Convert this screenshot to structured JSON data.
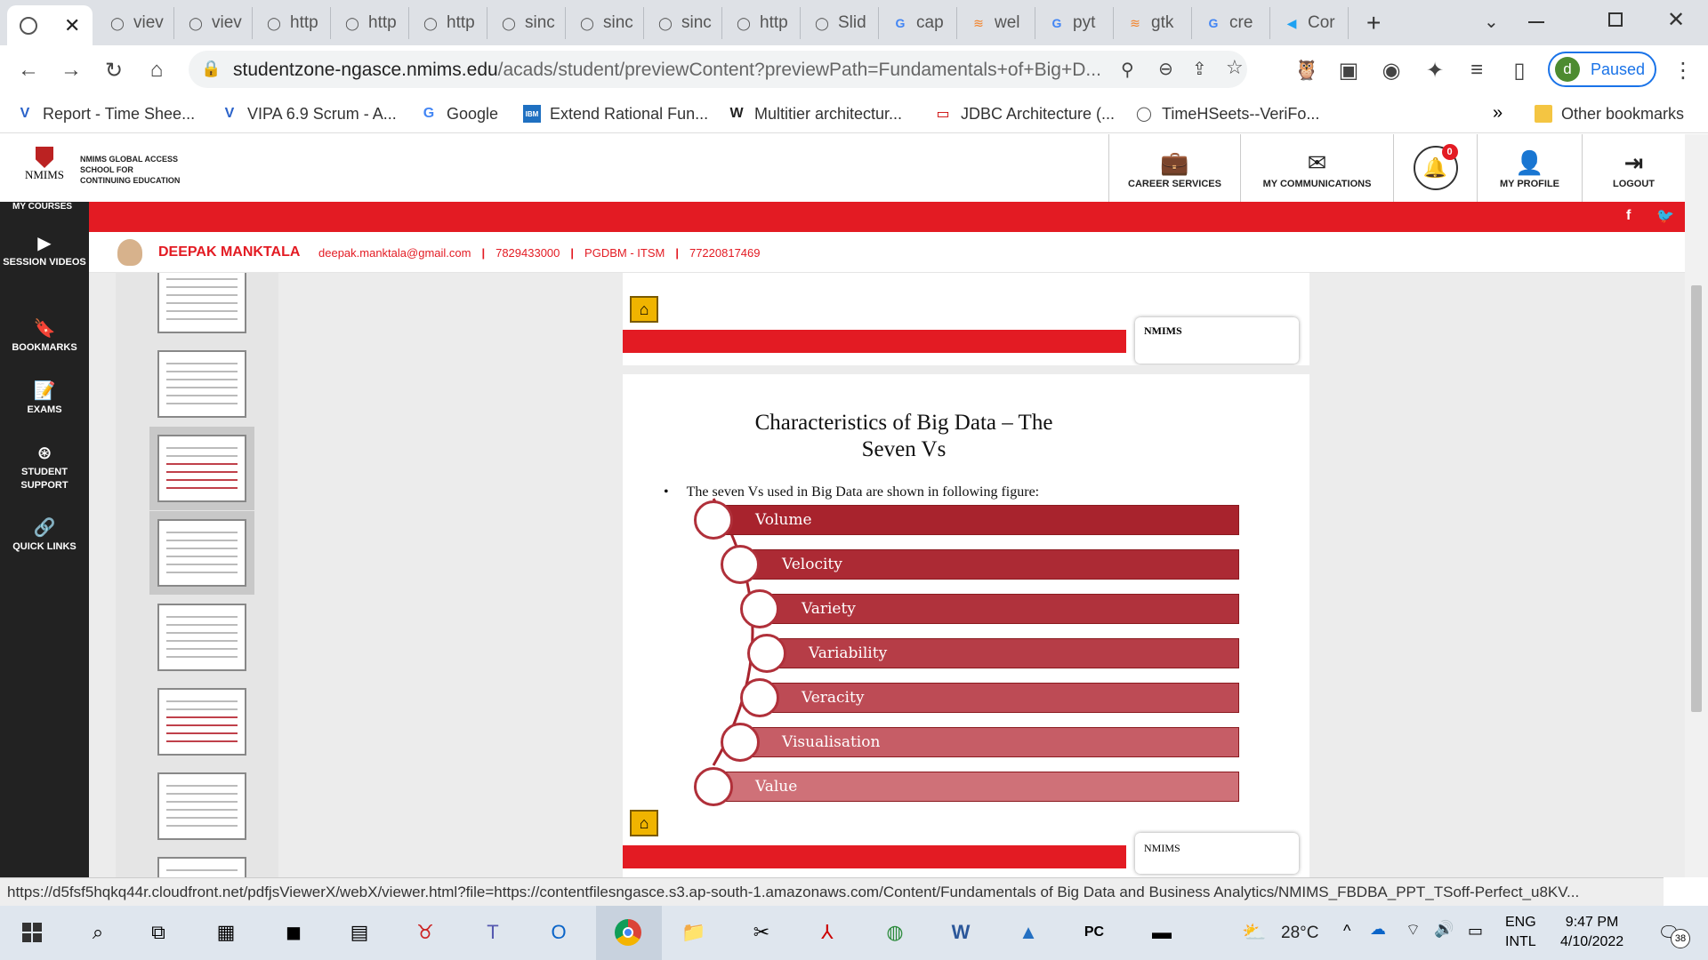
{
  "tabs": [
    {
      "label": "viev",
      "icon": "globe-icon"
    },
    {
      "label": "viev",
      "icon": "globe-icon"
    },
    {
      "label": "http",
      "icon": "globe-icon"
    },
    {
      "label": "http",
      "icon": "globe-icon"
    },
    {
      "label": "http",
      "icon": "globe-icon"
    },
    {
      "label": "sinc",
      "icon": "globe-icon"
    },
    {
      "label": "sinc",
      "icon": "globe-icon"
    },
    {
      "label": "sinc",
      "icon": "globe-icon"
    },
    {
      "label": "http",
      "icon": "globe-icon"
    },
    {
      "label": "Slid",
      "icon": "globe-icon"
    },
    {
      "label": "cap",
      "icon": "google-icon"
    },
    {
      "label": "wel",
      "icon": "stackoverflow-icon"
    },
    {
      "label": "pyt",
      "icon": "google-icon"
    },
    {
      "label": "gtk",
      "icon": "stackoverflow-icon"
    },
    {
      "label": "cre",
      "icon": "google-icon"
    },
    {
      "label": "Cor",
      "icon": "fish-icon"
    }
  ],
  "address": {
    "domain": "studentzone-ngasce.nmims.edu",
    "path": "/acads/student/previewContent?previewPath=Fundamentals+of+Big+D..."
  },
  "profile": {
    "initial": "d",
    "label": "Paused"
  },
  "bookmarks": [
    {
      "label": "Report - Time Shee...",
      "icon": "v-icon"
    },
    {
      "label": "VIPA 6.9 Scrum - A...",
      "icon": "v-icon"
    },
    {
      "label": "Google",
      "icon": "google-icon"
    },
    {
      "label": "Extend Rational Fun...",
      "icon": "ibm-icon"
    },
    {
      "label": "Multitier architectur...",
      "icon": "wikipedia-icon"
    },
    {
      "label": "JDBC Architecture (...",
      "icon": "oracle-icon"
    },
    {
      "label": "TimeHSeets--VeriFo...",
      "icon": "globe-icon"
    }
  ],
  "bookmarks_more": "»",
  "other_bookmarks": "Other bookmarks",
  "site": {
    "logo_text": "NMIMS",
    "school_lines": [
      "NMIMS GLOBAL ACCESS",
      "SCHOOL FOR",
      "CONTINUING EDUCATION"
    ],
    "nav": [
      {
        "label": "CAREER SERVICES",
        "icon": "briefcase-icon"
      },
      {
        "label": "MY COMMUNICATIONS",
        "icon": "envelope-icon"
      },
      {
        "label": "",
        "icon": "bell-icon",
        "badge": "0"
      },
      {
        "label": "MY PROFILE",
        "icon": "user-icon"
      },
      {
        "label": "LOGOUT",
        "icon": "logout-icon"
      }
    ],
    "my_courses": "MY COURSES"
  },
  "sidebar": [
    {
      "label": "SESSION VIDEOS",
      "icon": "play-icon"
    },
    {
      "label": "BOOKMARKS",
      "icon": "bookmark-icon"
    },
    {
      "label": "EXAMS",
      "icon": "exam-icon"
    },
    {
      "label": "STUDENT SUPPORT",
      "icon": "lifebuoy-icon"
    },
    {
      "label": "QUICK LINKS",
      "icon": "link-icon"
    }
  ],
  "user": {
    "name": "DEEPAK MANKTALA",
    "email": "deepak.manktala@gmail.com",
    "phone": "7829433000",
    "program": "PGDBM - ITSM",
    "id": "77220817469"
  },
  "slide": {
    "title_line1": "Characteristics of Big Data – The",
    "title_line2": "Seven Vs",
    "bullet": "The seven Vs used in Big Data are shown in following figure:",
    "vs": [
      "Volume",
      "Velocity",
      "Variety",
      "Variability",
      "Veracity",
      "Visualisation",
      "Value"
    ]
  },
  "status_url": "https://d5fsf5hqkq44r.cloudfront.net/pdfjsViewerX/webX/viewer.html?file=https://contentfilesngasce.s3.ap-south-1.amazonaws.com/Content/Fundamentals of Big Data and Business Analytics/NMIMS_FBDBA_PPT_TSoff-Perfect_u8KV...",
  "taskbar": {
    "temp": "28°C",
    "lang1": "ENG",
    "lang2": "INTL",
    "time": "9:47 PM",
    "date": "4/10/2022",
    "notif": "38"
  },
  "colors": {
    "red": "#e31b23",
    "sidebar": "#222222",
    "vbar": "#b2323c"
  }
}
